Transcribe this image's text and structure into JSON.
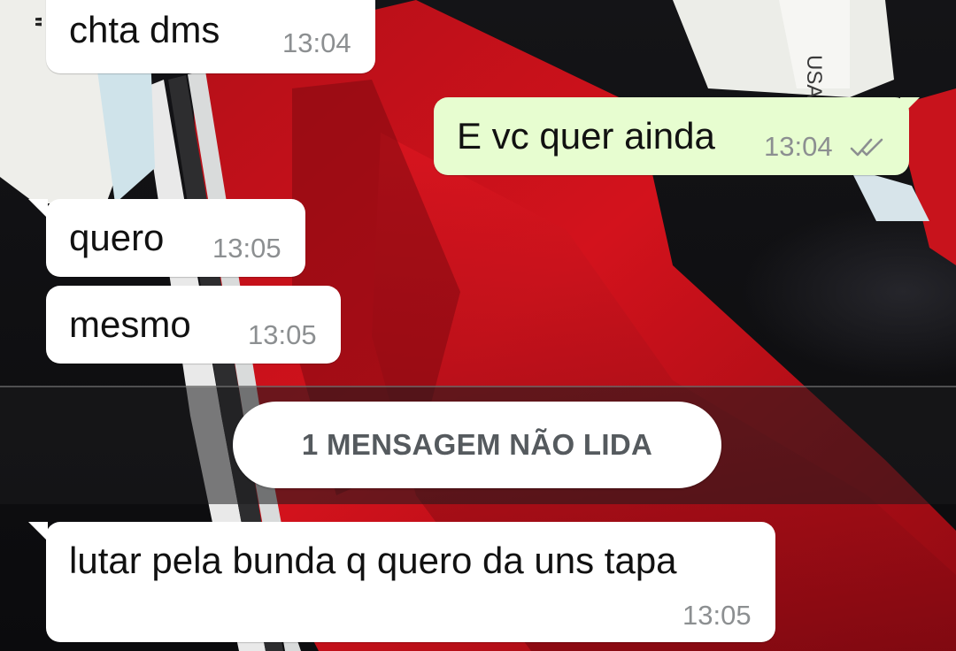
{
  "chat": {
    "messages": [
      {
        "direction": "incoming",
        "text": "chta dms",
        "time": "13:04"
      },
      {
        "direction": "outgoing",
        "text": "E vc quer ainda",
        "time": "13:04",
        "status_icon": "double-check-icon"
      },
      {
        "direction": "incoming",
        "text": "quero",
        "time": "13:05"
      },
      {
        "direction": "incoming",
        "text": "mesmo",
        "time": "13:05"
      },
      {
        "direction": "incoming",
        "text": "lutar pela bunda q quero da uns tapa",
        "time": "13:05"
      }
    ],
    "unread_divider": "1 MENSAGEM NÃO LIDA"
  },
  "wallpaper": {
    "shoe_label": "USA"
  },
  "colors": {
    "incoming_bubble": "#ffffff",
    "outgoing_bubble": "#e7fdd0",
    "timestamp": "#8c8f91",
    "ticks": "#8c8f91",
    "wallpaper_red": "#c4121c"
  }
}
